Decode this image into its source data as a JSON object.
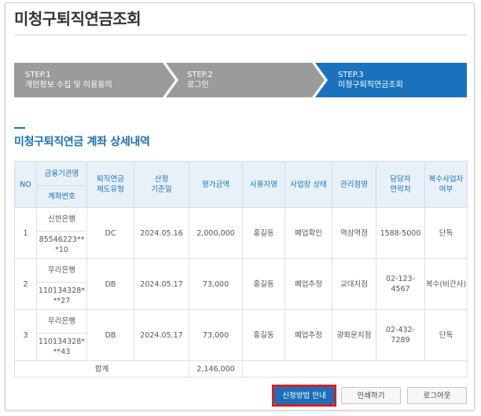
{
  "page_title": "미청구퇴직연금조회",
  "steps": [
    {
      "num": "STEP.1",
      "label": "개인정보 수집 및 이용동의"
    },
    {
      "num": "STEP.2",
      "label": "로그인"
    },
    {
      "num": "STEP.3",
      "label": "미청구퇴직연금조회"
    }
  ],
  "section_title": "미청구퇴직연금 계좌 상세내역",
  "table": {
    "headers": {
      "no": "NO",
      "institution": "금융기관명",
      "account": "계좌번호",
      "type_l1": "퇴직연금",
      "type_l2": "제도유형",
      "date_l1": "산정",
      "date_l2": "기준일",
      "amount": "평가금액",
      "employer": "사용자명",
      "status": "사업장 상태",
      "branch": "관리점명",
      "contact_l1": "담당자",
      "contact_l2": "연락처",
      "multi_l1": "복수사업자",
      "multi_l2": "여부"
    },
    "rows": [
      {
        "no": "1",
        "institution": "신한은행",
        "account_l1": "85546223**",
        "account_l2": "*10",
        "type": "DC",
        "date": "2024.05.16",
        "amount": "2,000,000",
        "employer": "홍길동",
        "status": "폐업확인",
        "branch": "역삼역점",
        "contact": "1588-5000",
        "multi": "단독"
      },
      {
        "no": "2",
        "institution": "우리은행",
        "account_l1": "110134328*",
        "account_l2": "**27",
        "type": "DB",
        "date": "2024.05.17",
        "amount": "73,000",
        "employer": "홍길동",
        "status": "폐업추정",
        "branch": "교대지점",
        "contact": "02-123-4567",
        "multi": "복수(비간사)"
      },
      {
        "no": "3",
        "institution": "우리은행",
        "account_l1": "110134328*",
        "account_l2": "**43",
        "type": "DB",
        "date": "2024.05.17",
        "amount": "73,000",
        "employer": "홍길동",
        "status": "폐업추정",
        "branch": "광화문지점",
        "contact": "02-432-7289",
        "multi": "단독"
      }
    ],
    "total_label": "합계",
    "total_amount": "2,146,000"
  },
  "buttons": {
    "guide": "신청방법 안내",
    "print": "인쇄하기",
    "logout": "로그아웃"
  },
  "colors": {
    "accent": "#1a72bc",
    "step_inactive": "#9b9b9b",
    "highlight": "#e01b1b"
  }
}
